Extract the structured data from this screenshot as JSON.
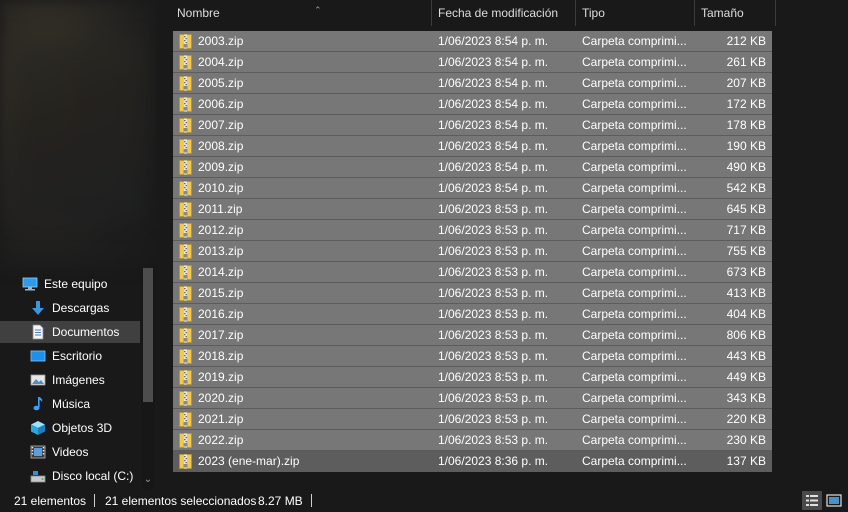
{
  "nav": {
    "items": [
      {
        "label": "Este equipo",
        "icon": "computer-icon"
      },
      {
        "label": "Descargas",
        "icon": "download-arrow-icon"
      },
      {
        "label": "Documentos",
        "icon": "documents-icon"
      },
      {
        "label": "Escritorio",
        "icon": "desktop-icon"
      },
      {
        "label": "Imágenes",
        "icon": "pictures-icon"
      },
      {
        "label": "Música",
        "icon": "music-note-icon"
      },
      {
        "label": "Objetos 3D",
        "icon": "cube-3d-icon"
      },
      {
        "label": "Videos",
        "icon": "film-icon"
      },
      {
        "label": "Disco local (C:)",
        "icon": "local-disk-icon"
      }
    ],
    "selected_item": "Documentos"
  },
  "columns": {
    "name": "Nombre",
    "date": "Fecha de modificación",
    "type": "Tipo",
    "size": "Tamaño"
  },
  "files": [
    {
      "name": "2003.zip",
      "date": "1/06/2023 8:54 p. m.",
      "type": "Carpeta comprimi...",
      "size": "212 KB"
    },
    {
      "name": "2004.zip",
      "date": "1/06/2023 8:54 p. m.",
      "type": "Carpeta comprimi...",
      "size": "261 KB"
    },
    {
      "name": "2005.zip",
      "date": "1/06/2023 8:54 p. m.",
      "type": "Carpeta comprimi...",
      "size": "207 KB"
    },
    {
      "name": "2006.zip",
      "date": "1/06/2023 8:54 p. m.",
      "type": "Carpeta comprimi...",
      "size": "172 KB"
    },
    {
      "name": "2007.zip",
      "date": "1/06/2023 8:54 p. m.",
      "type": "Carpeta comprimi...",
      "size": "178 KB"
    },
    {
      "name": "2008.zip",
      "date": "1/06/2023 8:54 p. m.",
      "type": "Carpeta comprimi...",
      "size": "190 KB"
    },
    {
      "name": "2009.zip",
      "date": "1/06/2023 8:54 p. m.",
      "type": "Carpeta comprimi...",
      "size": "490 KB"
    },
    {
      "name": "2010.zip",
      "date": "1/06/2023 8:54 p. m.",
      "type": "Carpeta comprimi...",
      "size": "542 KB"
    },
    {
      "name": "2011.zip",
      "date": "1/06/2023 8:53 p. m.",
      "type": "Carpeta comprimi...",
      "size": "645 KB"
    },
    {
      "name": "2012.zip",
      "date": "1/06/2023 8:53 p. m.",
      "type": "Carpeta comprimi...",
      "size": "717 KB"
    },
    {
      "name": "2013.zip",
      "date": "1/06/2023 8:53 p. m.",
      "type": "Carpeta comprimi...",
      "size": "755 KB"
    },
    {
      "name": "2014.zip",
      "date": "1/06/2023 8:53 p. m.",
      "type": "Carpeta comprimi...",
      "size": "673 KB"
    },
    {
      "name": "2015.zip",
      "date": "1/06/2023 8:53 p. m.",
      "type": "Carpeta comprimi...",
      "size": "413 KB"
    },
    {
      "name": "2016.zip",
      "date": "1/06/2023 8:53 p. m.",
      "type": "Carpeta comprimi...",
      "size": "404 KB"
    },
    {
      "name": "2017.zip",
      "date": "1/06/2023 8:53 p. m.",
      "type": "Carpeta comprimi...",
      "size": "806 KB"
    },
    {
      "name": "2018.zip",
      "date": "1/06/2023 8:53 p. m.",
      "type": "Carpeta comprimi...",
      "size": "443 KB"
    },
    {
      "name": "2019.zip",
      "date": "1/06/2023 8:53 p. m.",
      "type": "Carpeta comprimi...",
      "size": "449 KB"
    },
    {
      "name": "2020.zip",
      "date": "1/06/2023 8:53 p. m.",
      "type": "Carpeta comprimi...",
      "size": "343 KB"
    },
    {
      "name": "2021.zip",
      "date": "1/06/2023 8:53 p. m.",
      "type": "Carpeta comprimi...",
      "size": "220 KB"
    },
    {
      "name": "2022.zip",
      "date": "1/06/2023 8:53 p. m.",
      "type": "Carpeta comprimi...",
      "size": "230 KB"
    },
    {
      "name": "2023 (ene-mar).zip",
      "date": "1/06/2023 8:36 p. m.",
      "type": "Carpeta comprimi...",
      "size": "137 KB"
    }
  ],
  "status": {
    "count": "21 elementos",
    "selected": "21 elementos seleccionados",
    "size": "8.27 MB"
  },
  "colors": {
    "row_selected": "#777777",
    "row_focused": "#5d5d5d",
    "background": "#191919",
    "zip_yellow": "#f2c94c"
  }
}
